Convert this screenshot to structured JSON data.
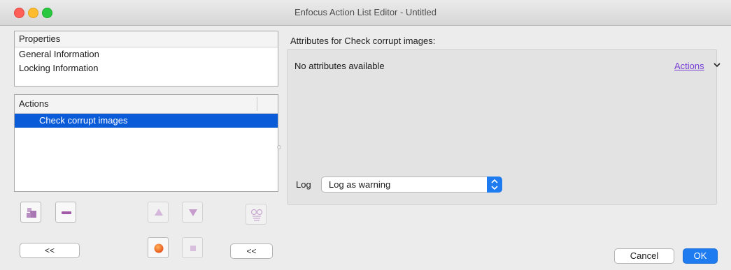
{
  "window": {
    "title": "Enfocus Action List Editor - Untitled"
  },
  "properties": {
    "header": "Properties",
    "items": [
      "General Information",
      "Locking Information"
    ]
  },
  "actions": {
    "header": "Actions",
    "items": [
      {
        "label": "Check corrupt images",
        "selected": true
      }
    ]
  },
  "toolbar": {
    "icons": [
      "add-action-icon",
      "remove-action-icon",
      "move-up-icon",
      "move-down-icon",
      "preview-glasses-icon",
      "record-icon",
      "stop-icon"
    ],
    "collapse_left_label": "<<",
    "collapse_right_label": "<<"
  },
  "attributes": {
    "title": "Attributes for Check corrupt images:",
    "empty_text": "No attributes available",
    "actions_link": "Actions",
    "log_label": "Log",
    "log_value": "Log as warning"
  },
  "footer": {
    "cancel_label": "Cancel",
    "ok_label": "OK"
  },
  "colors": {
    "selection": "#0a5bd8",
    "accent": "#1f7cf0",
    "link": "#7a3fd6"
  }
}
